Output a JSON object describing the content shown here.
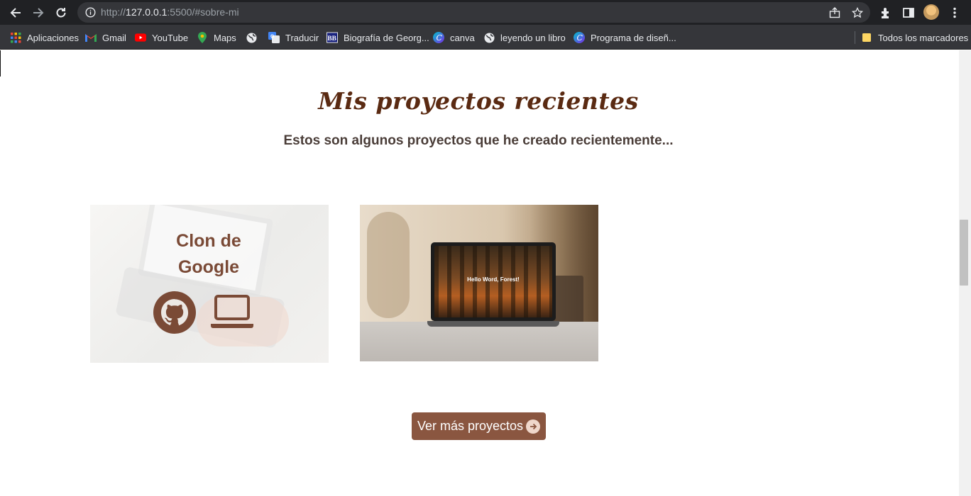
{
  "browser": {
    "url_host": "127.0.0.1",
    "url_rest": ":5500/#sobre-mi",
    "url_scheme": "http://",
    "bookmarks": [
      {
        "label": "Aplicaciones",
        "icon": "apps-grid-icon"
      },
      {
        "label": "Gmail",
        "icon": "gmail-icon"
      },
      {
        "label": "YouTube",
        "icon": "youtube-icon"
      },
      {
        "label": "Maps",
        "icon": "maps-pin-icon"
      },
      {
        "label": "",
        "icon": "globe-icon"
      },
      {
        "label": "Traducir",
        "icon": "translate-icon"
      },
      {
        "label": "Biografía de Georg...",
        "icon": "bb-icon"
      },
      {
        "label": "canva",
        "icon": "canva-icon"
      },
      {
        "label": "leyendo un libro",
        "icon": "globe-icon"
      },
      {
        "label": "Programa de diseñ...",
        "icon": "canva-icon"
      }
    ],
    "all_bookmarks_label": "Todos los marcadores"
  },
  "section": {
    "title": "Mis proyectos recientes",
    "subtitle": "Estos son algunos proyectos que he creado recientemente..."
  },
  "projects": [
    {
      "title": "Clon de Google"
    },
    {
      "screen_text": "Hello Word, Forest!"
    }
  ],
  "more_button": {
    "label": "Ver más proyectos"
  },
  "colors": {
    "title": "#5a2a12",
    "accent": "#8a5640",
    "chrome_dark": "#202124",
    "chrome_bar": "#35363a"
  }
}
